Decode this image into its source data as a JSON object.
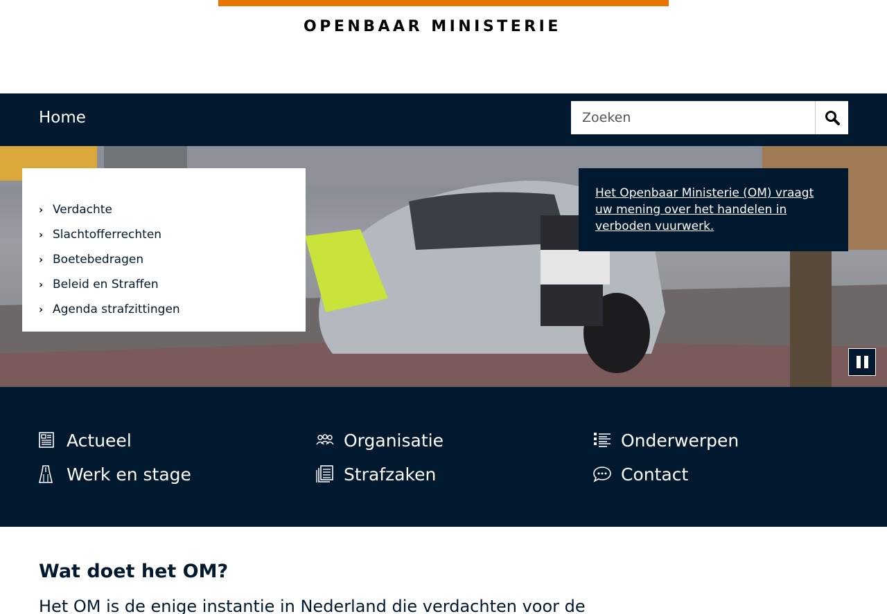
{
  "header": {
    "logo_text": "OPENBAAR MINISTERIE",
    "brand_color": "#e77500"
  },
  "nav": {
    "home_label": "Home",
    "bg_color": "#01192f"
  },
  "search": {
    "placeholder": "Zoeken",
    "icon": "search-icon"
  },
  "quick_links": [
    {
      "label": "Verdachte"
    },
    {
      "label": "Slachtofferrechten"
    },
    {
      "label": "Boetebedragen"
    },
    {
      "label": "Beleid en Straffen"
    },
    {
      "label": "Agenda strafzittingen"
    }
  ],
  "news": {
    "text": "Het Openbaar Ministerie (OM) vraagt uw mening over het handelen in verboden vuurwerk."
  },
  "carousel": {
    "pause_icon": "pause-icon"
  },
  "tiles": [
    {
      "label": "Actueel",
      "icon": "newspaper-icon"
    },
    {
      "label": "Organisatie",
      "icon": "people-icon"
    },
    {
      "label": "Onderwerpen",
      "icon": "list-icon"
    },
    {
      "label": "Werk en stage",
      "icon": "toga-icon"
    },
    {
      "label": "Strafzaken",
      "icon": "documents-icon"
    },
    {
      "label": "Contact",
      "icon": "chat-icon"
    }
  ],
  "intro": {
    "title": "Wat doet het OM?",
    "text": "Het OM is de enige instantie in Nederland die verdachten voor de"
  }
}
